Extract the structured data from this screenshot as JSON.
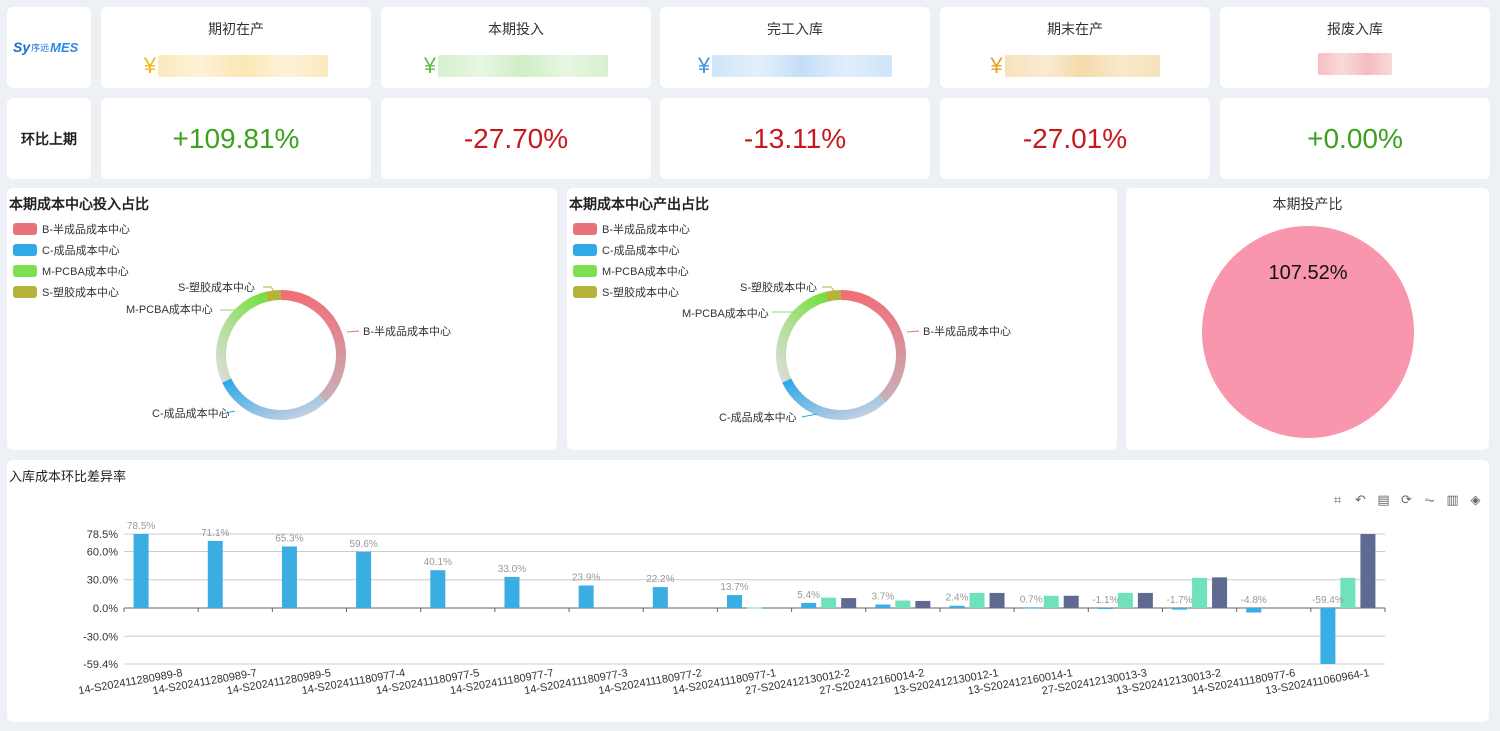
{
  "brand": {
    "logo_text": "MES",
    "logo_prefix": "Sy",
    "logo_cn": "序远"
  },
  "kpis": [
    {
      "title": "期初在产",
      "yen": "¥",
      "color": "#f3b81d",
      "blur": "#fbe6b1"
    },
    {
      "title": "本期投入",
      "yen": "¥",
      "color": "#5fbf45",
      "blur": "#cfeec5"
    },
    {
      "title": "完工入库",
      "yen": "¥",
      "color": "#3c98e6",
      "blur": "#c7e0f8"
    },
    {
      "title": "期末在产",
      "yen": "¥",
      "color": "#e6a02a",
      "blur": "#f5dcae"
    },
    {
      "title": "报废入库",
      "yen": "",
      "color": "#e07a82",
      "blur": "#f3c3c6"
    }
  ],
  "compare": {
    "row_label": "环比上期",
    "values": [
      "+109.81%",
      "-27.70%",
      "-13.11%",
      "-27.01%",
      "+0.00%"
    ]
  },
  "donut_input": {
    "title": "本期成本中心投入占比",
    "legend": [
      "B-半成品成本中心",
      "C-成品成本中心",
      "M-PCBA成本中心",
      "S-塑胶成本中心"
    ],
    "labels": [
      "B-半成品成本中心",
      "C-成品成本中心",
      "M-PCBA成本中心",
      "S-塑胶成本中心"
    ]
  },
  "donut_output": {
    "title": "本期成本中心产出占比",
    "legend": [
      "B-半成品成本中心",
      "C-成品成本中心",
      "M-PCBA成本中心",
      "S-塑胶成本中心"
    ],
    "labels": [
      "B-半成品成本中心",
      "C-成品成本中心",
      "M-PCBA成本中心",
      "S-塑胶成本中心"
    ]
  },
  "ratio": {
    "title": "本期投产比",
    "value": "107.52%",
    "color": "#f896ae"
  },
  "colors": {
    "b": "#e8717a",
    "c": "#31a8e8",
    "m": "#7de04f",
    "s": "#b6b43a",
    "bar1": "#3aaee2",
    "bar2": "#6fe2bd",
    "bar3": "#5e6a91"
  },
  "toolbox": [
    "crop-icon",
    "undo-icon",
    "data-view-icon",
    "restore-icon",
    "line-chart-icon",
    "bar-chart-icon",
    "stack-icon"
  ],
  "chart_data": [
    {
      "type": "pie",
      "title": "本期成本中心投入占比",
      "categories": [
        "B-半成品成本中心",
        "C-成品成本中心",
        "M-PCBA成本中心",
        "S-塑胶成本中心"
      ],
      "values": [
        38,
        30,
        28,
        4
      ]
    },
    {
      "type": "pie",
      "title": "本期成本中心产出占比",
      "categories": [
        "B-半成品成本中心",
        "C-成品成本中心",
        "M-PCBA成本中心",
        "S-塑胶成本中心"
      ],
      "values": [
        38,
        30,
        28,
        4
      ]
    },
    {
      "type": "pie",
      "title": "本期投产比",
      "categories": [
        ""
      ],
      "values": [
        107.52
      ]
    },
    {
      "type": "bar",
      "title": "入库成本环比差异率",
      "categories": [
        "14-S202411280989-8",
        "14-S202411280989-7",
        "14-S202411280989-5",
        "14-S202411180977-4",
        "14-S202411180977-5",
        "14-S202411180977-7",
        "14-S202411180977-3",
        "14-S202411180977-2",
        "14-S202411180977-1",
        "27-S202412130012-2",
        "27-S202412160014-2",
        "13-S202412130012-1",
        "13-S202412160014-1",
        "27-S202412130013-3",
        "13-S202412130013-2",
        "14-S202411180977-6",
        "13-S202411060964-1"
      ],
      "series": [
        {
          "values": [
            78.5,
            71.1,
            65.3,
            59.6,
            40.1,
            33.0,
            23.9,
            22.2,
            13.7,
            5.4,
            3.7,
            2.4,
            0.7,
            -1.1,
            -1.7,
            -4.8,
            -59.4
          ]
        },
        {
          "values": [
            0,
            0,
            0,
            0,
            0,
            0,
            0,
            0,
            0.5,
            11,
            8,
            16,
            13,
            16,
            32,
            0,
            32
          ]
        },
        {
          "values": [
            0,
            0,
            0,
            0,
            0,
            0,
            0,
            0,
            0,
            10.5,
            7.5,
            16,
            13,
            16,
            32.5,
            0,
            78.5
          ]
        }
      ],
      "y_ticks": [
        "78.5%",
        "60.0%",
        "30.0%",
        "0.0%",
        "-30.0%",
        "-59.4%"
      ],
      "ylim": [
        -59.4,
        78.5
      ]
    }
  ]
}
